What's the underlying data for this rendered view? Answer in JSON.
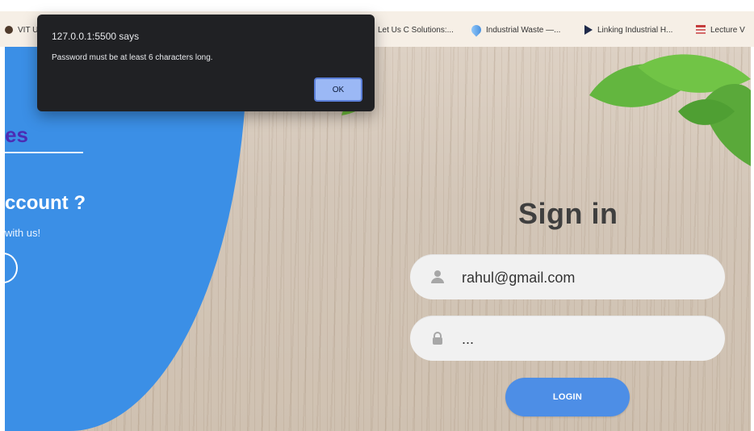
{
  "bookmarks": [
    {
      "label": "VIT Un",
      "icon": "circle-dark-icon"
    },
    {
      "label": "Let Us C Solutions:...",
      "icon": "none"
    },
    {
      "label": "Industrial Waste —...",
      "icon": "drop-icon"
    },
    {
      "label": "Linking Industrial H...",
      "icon": "triangle-icon"
    },
    {
      "label": "Lecture V",
      "icon": "grid-icon"
    }
  ],
  "left_panel": {
    "brand_fragment": "es",
    "account_title": "ccount ?",
    "account_sub": "with us!"
  },
  "signin": {
    "title": "Sign in",
    "email_value": "rahul@gmail.com",
    "password_value": "...",
    "login_label": "LOGIN"
  },
  "alert": {
    "title": "127.0.0.1:5500 says",
    "message": "Password must be at least 6 characters long.",
    "ok_label": "OK"
  },
  "colors": {
    "blue_panel": "#3b8fe6",
    "login_button": "#4d8ee6",
    "brand": "#4c2cb4"
  }
}
